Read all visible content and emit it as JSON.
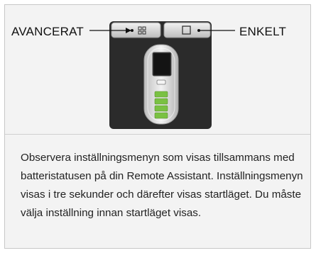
{
  "labels": {
    "advanced": "AVANCERAT",
    "simple": "ENKELT"
  },
  "buttons": {
    "advanced_icon": "advanced-mode-icon",
    "simple_icon": "simple-mode-icon"
  },
  "battery": {
    "level_fraction": 1.0,
    "segments_total": 4,
    "segments_lit": 4,
    "color": "#7ac143"
  },
  "caption": {
    "text": "Observera inställningsmenyn som visas tillsammans med batteristatusen på din Remote Assistant. Inställningsmenyn visas i tre sekunder och därefter visas startläget. Du måste välja inställning innan startläget visas."
  },
  "colors": {
    "panel_bg": "#f3f3f3",
    "device_dark": "#2b2b2b",
    "device_body": "#dcdcdc"
  }
}
